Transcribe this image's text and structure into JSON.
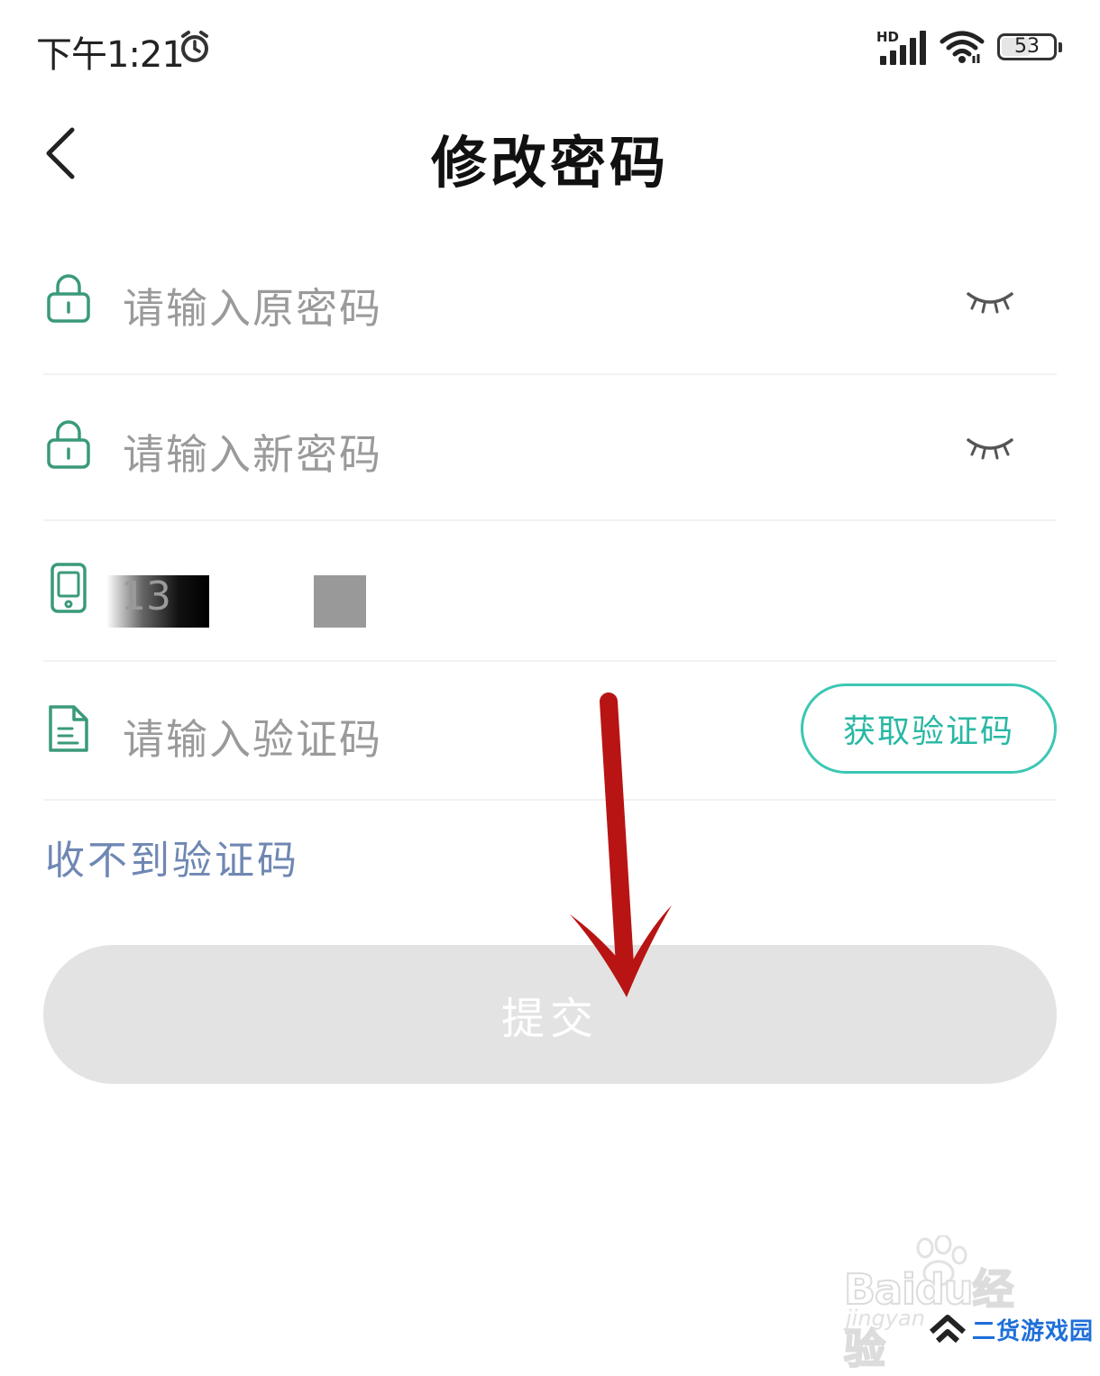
{
  "status_bar": {
    "time": "下午1:21",
    "network_label": "HD",
    "battery_level": "53"
  },
  "header": {
    "title": "修改密码"
  },
  "form": {
    "old_password_placeholder": "请输入原密码",
    "new_password_placeholder": "请输入新密码",
    "phone_value_visible": "13",
    "code_placeholder": "请输入验证码",
    "get_code_label": "获取验证码"
  },
  "links": {
    "no_code": "收不到验证码"
  },
  "actions": {
    "submit_label": "提交"
  },
  "watermarks": {
    "baidu_text": "Baidu经验",
    "baidu_sub": "jingyan",
    "site_text": "二货游戏园"
  },
  "icons": [
    "alarm-icon",
    "signal-icon",
    "wifi-icon",
    "battery-icon",
    "back-icon",
    "lock-icon",
    "eye-closed-icon",
    "phone-icon",
    "document-icon",
    "arrow-annotation"
  ],
  "colors": {
    "accent_green": "#3cc7b4",
    "icon_green": "#3a9a78",
    "link_blue": "#6f87b3",
    "submit_disabled_bg": "#e3e3e3",
    "arrow_red": "#b81414"
  }
}
